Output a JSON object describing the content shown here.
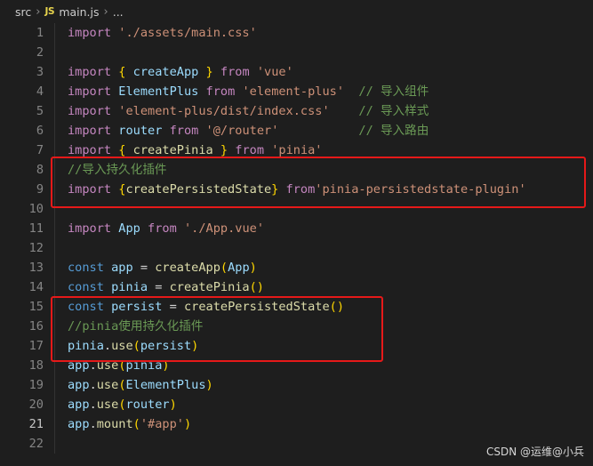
{
  "breadcrumb": {
    "folder": "src",
    "file_icon": "JS",
    "file": "main.js",
    "more": "..."
  },
  "lines": [
    {
      "n": "1"
    },
    {
      "n": "2"
    },
    {
      "n": "3"
    },
    {
      "n": "4"
    },
    {
      "n": "5"
    },
    {
      "n": "6"
    },
    {
      "n": "7"
    },
    {
      "n": "8"
    },
    {
      "n": "9"
    },
    {
      "n": "10"
    },
    {
      "n": "11"
    },
    {
      "n": "12"
    },
    {
      "n": "13"
    },
    {
      "n": "14"
    },
    {
      "n": "15"
    },
    {
      "n": "16"
    },
    {
      "n": "17"
    },
    {
      "n": "18"
    },
    {
      "n": "19"
    },
    {
      "n": "20"
    },
    {
      "n": "21"
    },
    {
      "n": "22"
    }
  ],
  "code": {
    "l1": {
      "kw": "import",
      "str": "'./assets/main.css'"
    },
    "l3": {
      "kw": "import",
      "name": "createApp",
      "from": "from",
      "str": "'vue'"
    },
    "l4": {
      "kw": "import",
      "name": "ElementPlus",
      "from": "from",
      "str": "'element-plus'",
      "cmt": "// 导入组件"
    },
    "l5": {
      "kw": "import",
      "str": "'element-plus/dist/index.css'",
      "cmt": "// 导入样式"
    },
    "l6": {
      "kw": "import",
      "name": "router",
      "from": "from",
      "str": "'@/router'",
      "cmt": "// 导入路由"
    },
    "l7": {
      "kw": "import",
      "name": "createPinia",
      "from": "from",
      "str": "'pinia'"
    },
    "l8": {
      "cmt": "//导入持久化插件"
    },
    "l9": {
      "kw": "import",
      "name": "createPersistedState",
      "from": "from",
      "str": "'pinia-persistedstate-plugin'"
    },
    "l11": {
      "kw": "import",
      "name": "App",
      "from": "from",
      "str": "'./App.vue'"
    },
    "l13": {
      "kw": "const",
      "var": "app",
      "fn": "createApp",
      "arg": "App"
    },
    "l14": {
      "kw": "const",
      "var": "pinia",
      "fn": "createPinia"
    },
    "l15": {
      "kw": "const",
      "var": "persist",
      "fn": "createPersistedState"
    },
    "l16": {
      "cmt": "//pinia使用持久化插件"
    },
    "l17": {
      "obj": "pinia",
      "fn": "use",
      "arg": "persist"
    },
    "l18": {
      "obj": "app",
      "fn": "use",
      "arg": "pinia"
    },
    "l19": {
      "obj": "app",
      "fn": "use",
      "arg": "ElementPlus"
    },
    "l20": {
      "obj": "app",
      "fn": "use",
      "arg": "router"
    },
    "l21": {
      "obj": "app",
      "fn": "mount",
      "str": "'#app'"
    }
  },
  "watermark": "CSDN @运维@小兵",
  "colors": {
    "background": "#1e1e1e",
    "highlight_box": "#e61919",
    "keyword": "#c586c0",
    "string": "#ce9178",
    "comment": "#6a9955",
    "function": "#dcdcaa",
    "variable": "#9cdcfe"
  }
}
